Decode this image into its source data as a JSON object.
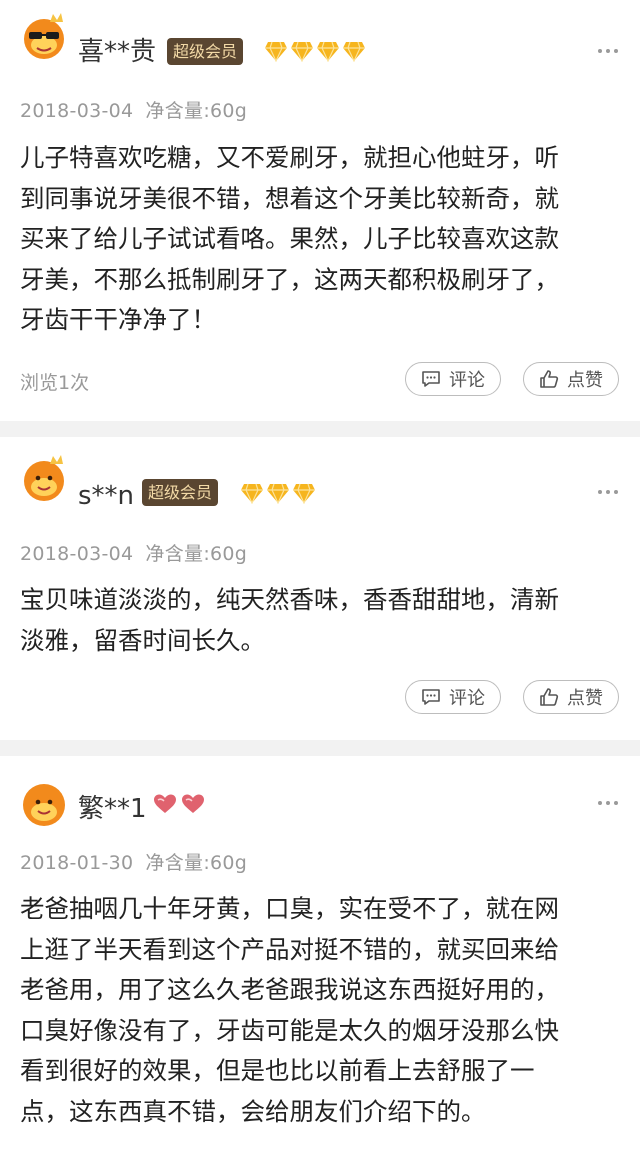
{
  "reviews": [
    {
      "username": "喜**贵",
      "member_badge": "超级会员",
      "level_icons": [
        "diamond-icon",
        "diamond-icon",
        "diamond-icon",
        "diamond-icon"
      ],
      "date": "2018-03-04",
      "spec": "净含量:60g",
      "content_lines": [
        "儿子特喜欢吃糖，又不爱刷牙，就担心他蛀牙，听",
        "到同事说牙美很不错，想着这个牙美比较新奇，就",
        "买来了给儿子试试看咯。果然，儿子比较喜欢这款",
        "牙美，不那么抵制刷牙了，这两天都积极刷牙了，",
        "牙齿干干净净了！"
      ],
      "views": "浏览1次",
      "comment_label": "评论",
      "like_label": "点赞"
    },
    {
      "username": "s**n",
      "member_badge": "超级会员",
      "level_icons": [
        "diamond-icon",
        "diamond-icon",
        "diamond-icon"
      ],
      "date": "2018-03-04",
      "spec": "净含量:60g",
      "content_lines": [
        "宝贝味道淡淡的，纯天然香味，香香甜甜地，清新",
        "淡雅，留香时间长久。"
      ],
      "comment_label": "评论",
      "like_label": "点赞"
    },
    {
      "username": "繁**1",
      "level_icons": [
        "heart-icon",
        "heart-icon"
      ],
      "date": "2018-01-30",
      "spec": "净含量:60g",
      "content_lines": [
        "老爸抽咽几十年牙黄，口臭，实在受不了，就在网",
        "上逛了半天看到这个产品对挺不错的，就买回来给",
        "老爸用，用了这么久老爸跟我说这东西挺好用的，",
        "口臭好像没有了，牙齿可能是太久的烟牙没那么快",
        "看到很好的效果，但是也比以前看上去舒服了一",
        "点，这东西真不错，会给朋友们介绍下的。"
      ]
    }
  ],
  "colors": {
    "vip_bg": "#5a4631",
    "vip_text": "#f2d9a6",
    "diamond": "#f6b51e",
    "heart": "#e0626e",
    "avatar": "#f28a1c"
  }
}
